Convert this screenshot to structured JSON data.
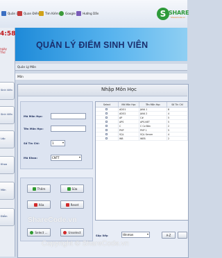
{
  "toolbar": {
    "items": [
      {
        "label": "Quản Lý",
        "icon": "manage-icon",
        "color": "#3b6fc2"
      },
      {
        "label": "Quan Điểm",
        "icon": "grades-icon",
        "color": "#c23b3b"
      },
      {
        "label": "Tìm Kiếm",
        "icon": "search-icon",
        "color": "#d0a21a"
      },
      {
        "label": "Google",
        "icon": "google-icon",
        "color": "#3d9a3a"
      },
      {
        "label": "Hướng Dẫn",
        "icon": "help-icon",
        "color": "#7a5bb8"
      }
    ]
  },
  "logo": {
    "letter": "S",
    "text": "SHARE",
    "sub": "ShareCode.vn"
  },
  "sidebar": {
    "clock": "4:58",
    "date_line1": "ngày",
    "date_line2": "Thứ",
    "items": [
      {
        "label": "Sinh Viên"
      },
      {
        "label": "Sinh Viên"
      },
      {
        "label": "Lớp"
      },
      {
        "label": "Khoa"
      },
      {
        "label": "Môn"
      },
      {
        "label": "Điểm"
      }
    ]
  },
  "banner": {
    "title": "QUẢN LÝ ĐIỂM SINH VIÊN"
  },
  "window": {
    "title": "Quản Lý Môn",
    "menu": "Môn"
  },
  "form": {
    "title": "Nhập Môn Học",
    "ma_mon_label": "Mã Môn Học:",
    "ma_mon_value": "",
    "ten_mon_label": "Tên Môn Học:",
    "ten_mon_value": "",
    "so_tin_chi_label": "Số Tín Chỉ:",
    "so_tin_chi_value": "1",
    "ma_khoa_label": "Mã Khoa:",
    "ma_khoa_value": "CNTT"
  },
  "actions": {
    "them": "Thêm",
    "sua": "Sửa",
    "xoa": "Xóa",
    "reset": "Reset",
    "select": "Select ...",
    "unselect": "Unselect"
  },
  "grid": {
    "headers": [
      "Select",
      "Mã Môn Học",
      "Tên Môn Học",
      "Số Tín Chỉ"
    ],
    "rows": [
      {
        "ma": "ADO1",
        "ten": "JAVA 1",
        "tc": "8"
      },
      {
        "ma": "ADO2",
        "ten": "JAVA 2",
        "tc": "4"
      },
      {
        "ma": "AP",
        "ten": "C#",
        "tc": "5"
      },
      {
        "ma": "APS",
        "ten": "APS.NET",
        "tc": "5"
      },
      {
        "ma": "C",
        "ten": "C Cơ Bản",
        "tc": "2"
      },
      {
        "ma": "PHP",
        "ten": "PHP 1",
        "tc": "5"
      },
      {
        "ma": "SQL",
        "ten": "SQL Server",
        "tc": "4"
      },
      {
        "ma": "WB",
        "ten": "WEB",
        "tc": "2"
      }
    ]
  },
  "bottom": {
    "sort_label": "Sắp Xếp",
    "sort_value": "tênmon",
    "az_label": "A-Z"
  },
  "watermark": {
    "line1": "ShareCode.vn",
    "line2": "Copyright © ShareCode.vn"
  }
}
